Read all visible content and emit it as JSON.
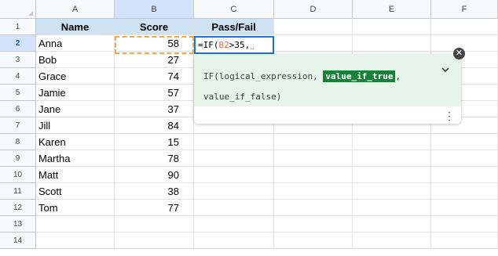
{
  "columns": [
    "A",
    "B",
    "C",
    "D",
    "E",
    "F"
  ],
  "rows": [
    {
      "num": "1",
      "a": "Name",
      "b": "Score",
      "c": "Pass/Fail"
    },
    {
      "num": "2",
      "a": "Anna",
      "b": "58",
      "c": ""
    },
    {
      "num": "3",
      "a": "Bob",
      "b": "27",
      "c": ""
    },
    {
      "num": "4",
      "a": "Grace",
      "b": "74",
      "c": ""
    },
    {
      "num": "5",
      "a": "Jamie",
      "b": "57",
      "c": ""
    },
    {
      "num": "6",
      "a": "Jane",
      "b": "37",
      "c": ""
    },
    {
      "num": "7",
      "a": "Jill",
      "b": "84",
      "c": ""
    },
    {
      "num": "8",
      "a": "Karen",
      "b": "15",
      "c": ""
    },
    {
      "num": "9",
      "a": "Martha",
      "b": "78",
      "c": ""
    },
    {
      "num": "10",
      "a": "Matt",
      "b": "90",
      "c": ""
    },
    {
      "num": "11",
      "a": "Scott",
      "b": "38",
      "c": ""
    },
    {
      "num": "12",
      "a": "Tom",
      "b": "77",
      "c": ""
    },
    {
      "num": "13",
      "a": "",
      "b": "",
      "c": ""
    },
    {
      "num": "14",
      "a": "",
      "b": "",
      "c": ""
    }
  ],
  "active_cell": {
    "prefix": "=IF(",
    "ref": "B2",
    "suffix": ">35,"
  },
  "tooltip": {
    "func": "IF(",
    "arg1": "logical_expression,",
    "arg2_active": "value_if_true",
    "arg2_comma": ",",
    "arg3": "value_if_false)"
  },
  "icons": {
    "close": "close-icon",
    "chevron": "chevron-down-icon",
    "more": "more-vert-icon"
  },
  "colors": {
    "header_fill": "#cfe2f3",
    "selection": "#1a73e8",
    "copy_border": "#f4a64a",
    "tooltip_bg": "#e6f4ea",
    "active_arg": "#188038"
  }
}
